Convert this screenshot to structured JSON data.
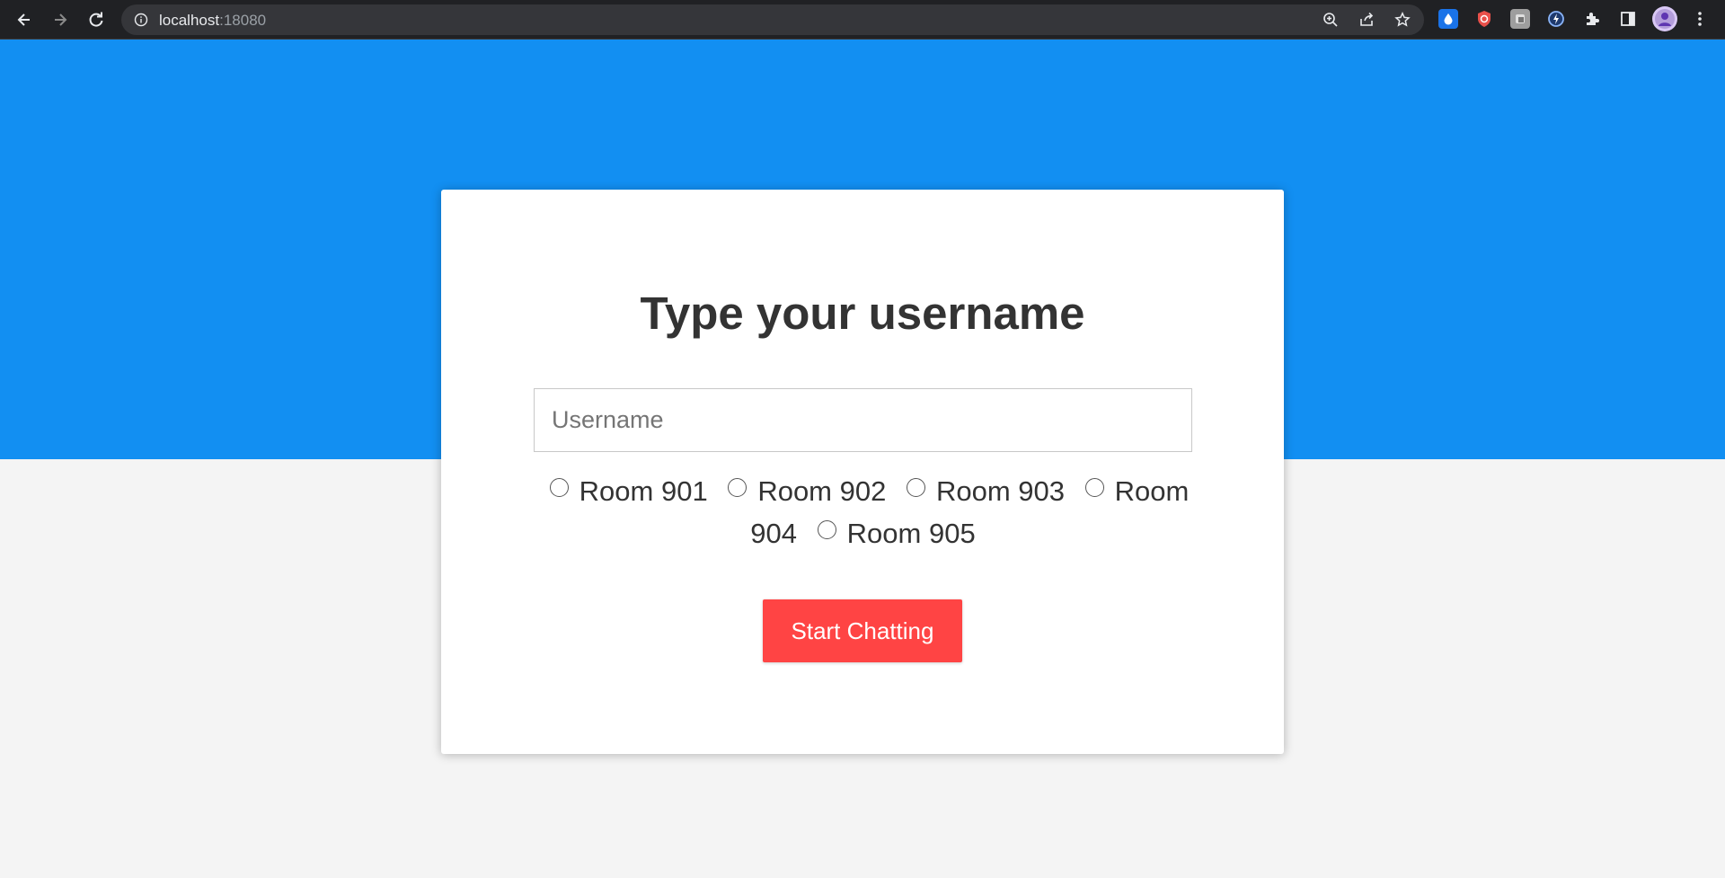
{
  "browser": {
    "url_host": "localhost",
    "url_port": ":18080"
  },
  "login": {
    "title": "Type your username",
    "username_placeholder": "Username",
    "rooms": [
      {
        "label": "Room 901"
      },
      {
        "label": "Room 902"
      },
      {
        "label": "Room 903"
      },
      {
        "label": "Room 904"
      },
      {
        "label": "Room 905"
      }
    ],
    "submit_label": "Start Chatting"
  },
  "colors": {
    "hero": "#128ff2",
    "page_background": "#f4f4f4",
    "button": "#ff4444",
    "browser_chrome": "#202124"
  },
  "icons": {
    "back": "arrow-left-icon",
    "forward": "arrow-right-icon",
    "reload": "reload-icon",
    "site_info": "info-icon",
    "zoom": "zoom-icon",
    "share": "share-icon",
    "bookmark": "star-icon",
    "extensions": [
      "water-drop-extension-icon",
      "shield-extension-icon",
      "gray-extension-icon",
      "bolt-extension-icon",
      "puzzle-icon",
      "side-panel-icon",
      "profile-avatar",
      "menu-dots-icon"
    ]
  }
}
